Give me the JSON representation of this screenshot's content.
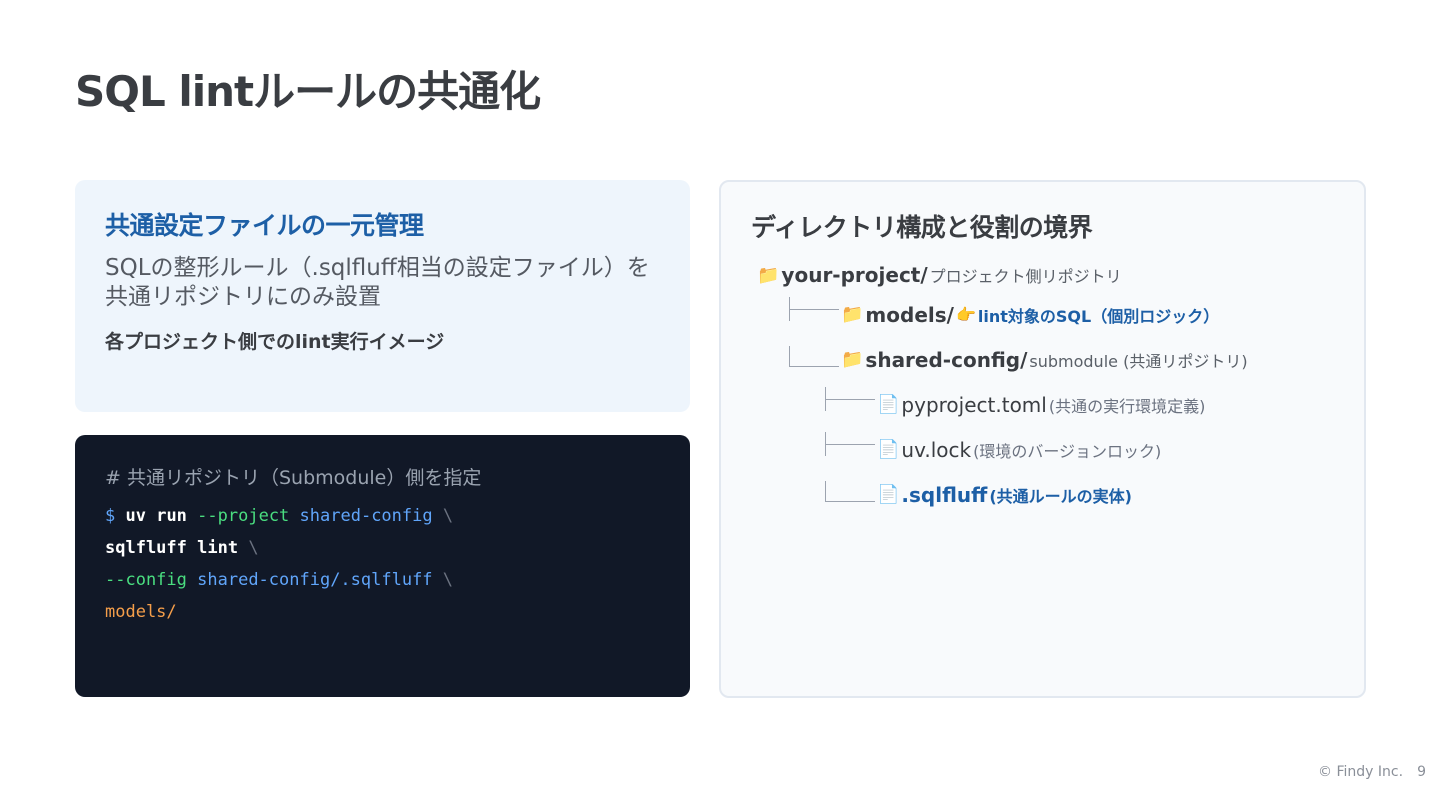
{
  "title": "SQL lintルールの共通化",
  "info": {
    "heading": "共通設定ファイルの一元管理",
    "description": "SQLの整形ルール（.sqlfluff相当の設定ファイル）を共通リポジトリにのみ設置",
    "subheading": "各プロジェクト側でのlint実行イメージ"
  },
  "code": {
    "comment": "# 共通リポジトリ（Submodule）側を指定",
    "line1": {
      "prompt": "$",
      "cmd": "uv run",
      "opt": "--project",
      "arg": "shared-config",
      "bs": "\\"
    },
    "line2": {
      "cmd": "sqlfluff lint",
      "bs": "\\"
    },
    "line3": {
      "opt": "--config",
      "arg": "shared-config/.sqlfluff",
      "bs": "\\"
    },
    "line4": {
      "path": "models/"
    }
  },
  "directory": {
    "heading": "ディレクトリ構成と役割の境界",
    "root": {
      "icon": "folder-icon",
      "name": "your-project/",
      "note": "プロジェクト側リポジトリ"
    },
    "models": {
      "icon": "folder-icon",
      "name": "models/",
      "pointer": "👉",
      "note": "lint対象のSQL（個別ロジック）"
    },
    "shared": {
      "icon": "folder-icon",
      "name": "shared-config/",
      "note": "submodule (共通リポジトリ)"
    },
    "pyproject": {
      "icon": "file-icon",
      "name": "pyproject.toml",
      "note": "(共通の実行環境定義)"
    },
    "uvlock": {
      "icon": "file-icon",
      "name": "uv.lock",
      "note": "(環境のバージョンロック)"
    },
    "sqlfluff": {
      "icon": "file-icon",
      "name": ".sqlfluff",
      "note": "(共通ルールの実体)"
    }
  },
  "footer": {
    "copyright": "© Findy Inc.",
    "page": "9"
  }
}
